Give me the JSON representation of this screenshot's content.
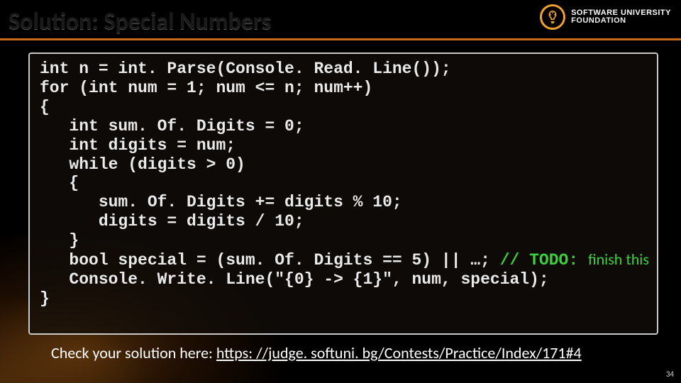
{
  "slide": {
    "title": "Solution: Special Numbers",
    "slide_number": "34"
  },
  "logo": {
    "line1": "SOFTWARE UNIVERSITY",
    "line2": "FOUNDATION"
  },
  "code": {
    "l1": "int n = int. Parse(Console. Read. Line());",
    "l2": "for (int num = 1; num <= n; num++)",
    "l3": "{",
    "l4": "   int sum. Of. Digits = 0;",
    "l5": "   int digits = num;",
    "l6": "   while (digits > 0)",
    "l7": "   {",
    "l8": "      sum. Of. Digits += digits % 10;",
    "l9": "      digits = digits / 10;",
    "l10": "   }",
    "l11a": "   bool special = (sum. Of. Digits == 5) || …; ",
    "l11b": "// TODO: ",
    "l11c": "finish this",
    "l12": "   Console. Write. Line(\"{0} -> {1}\", num, special);",
    "l13": "}"
  },
  "footer": {
    "prefix": "Check your solution here: ",
    "link_text": "https: //judge. softuni. bg/Contests/Practice/Index/171#4",
    "link_href": "https://judge.softuni.bg/Contests/Practice/Index/171#4"
  }
}
